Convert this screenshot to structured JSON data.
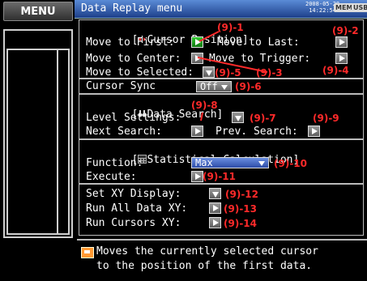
{
  "sidebar": {
    "menu_label": "MENU"
  },
  "titlebar": {
    "title": "Data Replay menu",
    "date": "2008-05-28",
    "time": "14:22:54",
    "mem_badge": "MEM",
    "usb_badge": "USB"
  },
  "cursor_position": {
    "header": "Cursor Position]",
    "header_bracket": "[",
    "move_first_label": "Move to First:",
    "move_last_label": "Move to Last:",
    "move_center_label": "Move to Center:",
    "move_trigger_label": "Move to Trigger:",
    "move_selected_label": "Move to Selected:",
    "callouts": {
      "c1": "(9)-1",
      "c2": "(9)-2",
      "c3": "(9)-3",
      "c4": "(9)-4",
      "c5": "(9)-5"
    }
  },
  "cursor_sync": {
    "label": "Cursor Sync",
    "value": "Off",
    "callout": "(9)-6"
  },
  "data_search": {
    "header": "Data Search]",
    "header_bracket": "[",
    "level_label": "Level Settings:",
    "next_label": "Next Search:",
    "prev_label": "Prev. Search:",
    "callouts": {
      "c7": "(9)-7",
      "c8": "(9)-8",
      "c9": "(9)-9"
    }
  },
  "statistical": {
    "header": "Statistical Calculation]",
    "header_bracket": "[",
    "function_label": "Function:",
    "function_value": "Max",
    "execute_label": "Execute:",
    "callouts": {
      "c10": "(9)-10",
      "c11": "(9)-11"
    }
  },
  "xy": {
    "set_label": "Set XY Display:",
    "run_all_label": "Run All Data XY:",
    "run_cursors_label": "Run Cursors XY:",
    "callouts": {
      "c12": "(9)-12",
      "c13": "(9)-13",
      "c14": "(9)-14"
    }
  },
  "help": {
    "line1": "Moves the currently selected cursor",
    "line2": "to the position of the first data."
  },
  "colors": {
    "callout": "#ff2a2a",
    "titlebar": "#3a66b8",
    "accent_green": "#22aa22"
  }
}
